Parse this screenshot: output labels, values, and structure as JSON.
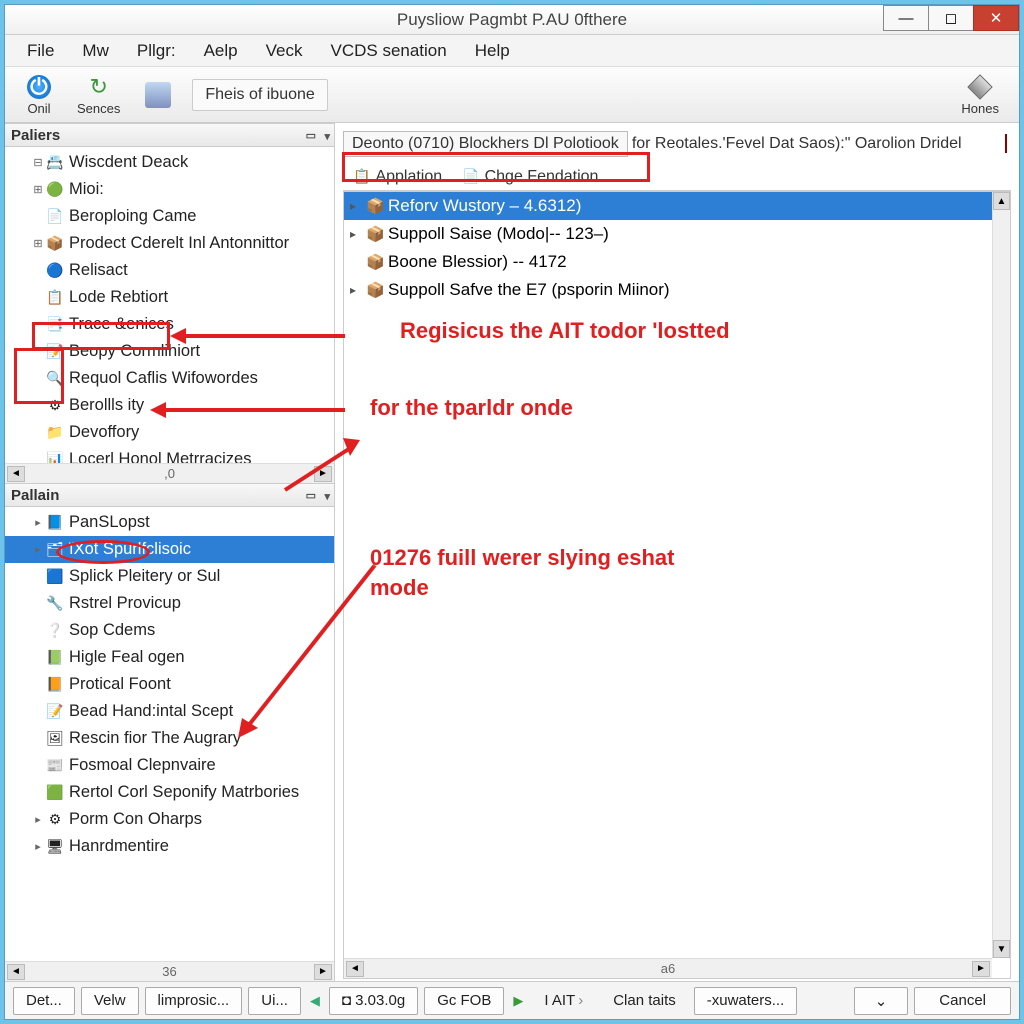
{
  "title": "Puysliow Pagmbt P.AU 0fthere",
  "menus": [
    "File",
    "Mw",
    "Pllgr:",
    "Aelp",
    "Veck",
    "VCDS senation",
    "Help"
  ],
  "toolbar": {
    "onil": "Onil",
    "sences": "Sences",
    "fheis": "Fheis of ibuone",
    "hones": "Hones"
  },
  "panels": {
    "paliers": {
      "title": "Paliers",
      "items": [
        {
          "icon": "📇",
          "label": "Wiscdent Deack",
          "expander": "⊟"
        },
        {
          "icon": "🟢",
          "label": "Mioi:",
          "expander": "⊞"
        },
        {
          "icon": "📄",
          "label": "Beroploing Came",
          "expander": ""
        },
        {
          "icon": "📦",
          "label": "Prodect Cderelt Inl Antonnittor",
          "expander": "⊞"
        },
        {
          "icon": "🔵",
          "label": "Relisact",
          "expander": ""
        },
        {
          "icon": "📋",
          "label": "Lode Rebtiort",
          "expander": ""
        },
        {
          "icon": "📑",
          "label": "Trace &enices",
          "expander": ""
        },
        {
          "icon": "📝",
          "label": "Beopy Cormlihiort",
          "expander": ""
        },
        {
          "icon": "🔍",
          "label": "Requol Caflis Wifowordes",
          "expander": ""
        },
        {
          "icon": "⚙",
          "label": "Berollls ity",
          "expander": ""
        },
        {
          "icon": "📁",
          "label": "Devoffory",
          "expander": ""
        },
        {
          "icon": "📊",
          "label": "Locerl Honol Metrracizes",
          "expander": ""
        }
      ],
      "scroll_label": ",0"
    },
    "pallain": {
      "title": "Pallain",
      "items": [
        {
          "icon": "📘",
          "label": "PanSLopst",
          "expander": "▸"
        },
        {
          "icon": "🗂",
          "label": "ïXot Spurlfclisoic",
          "expander": "▸",
          "selected": true
        },
        {
          "icon": "🟦",
          "label": "Splick Pleitery or Sul",
          "expander": ""
        },
        {
          "icon": "🔧",
          "label": "Rstrel Provicup",
          "expander": ""
        },
        {
          "icon": "❔",
          "label": "Sop Cdems",
          "expander": ""
        },
        {
          "icon": "📗",
          "label": "Higle Feal ogen",
          "expander": ""
        },
        {
          "icon": "📙",
          "label": "Protical Foont",
          "expander": ""
        },
        {
          "icon": "📝",
          "label": "Bead Hand:intal Scept",
          "expander": ""
        },
        {
          "icon": "🖼",
          "label": "Rescin fior The Augrary",
          "expander": ""
        },
        {
          "icon": "📰",
          "label": "Fosmoal Clepnvaire",
          "expander": ""
        },
        {
          "icon": "🟩",
          "label": "Rertol Corl Seponify Matrbories",
          "expander": ""
        },
        {
          "icon": "⚙",
          "label": "Porm Con Oharps",
          "expander": "▸"
        },
        {
          "icon": "🖥",
          "label": "Hanrdmentire",
          "expander": "▸"
        }
      ],
      "scroll_label": "36"
    }
  },
  "breadcrumb": {
    "box": "Deonto (0710) Blockhers Dl Polotiook",
    "rest": "for Reotales.'Fevel Dat Saos):\" Oarolion Dridel"
  },
  "subtabs": {
    "applation": "Applation",
    "chge": "Chge Fendation"
  },
  "main_items": [
    {
      "expander": "▸",
      "icon": "📦",
      "label": "Reforv Wustory – 4.6312)",
      "selected": true
    },
    {
      "expander": "▸",
      "icon": "📦",
      "label": "Suppoll Saise (Modo|-- 123–)"
    },
    {
      "expander": "",
      "icon": "📦",
      "label": "Boone Blessior) -- 4172"
    },
    {
      "expander": "▸",
      "icon": "📦",
      "label": "Suppoll Safve the E7 (psporin Miinor)"
    }
  ],
  "main_scroll_label": "a6",
  "bottom": {
    "det": "Det...",
    "velw": "Velw",
    "improsic": "limprosic...",
    "ui": "Ui...",
    "num": "3.03.0g",
    "gfob": "Gc FOB",
    "iait": "I AIT",
    "clantaits": "Clan taits",
    "xuwaters": "-xuwaters...",
    "cancel": "Cancel"
  },
  "annotations": {
    "line1": "Regisicus the AIT todor 'lostted",
    "line2": "for the tparldr onde",
    "line3a": "01276 fuill werer slying eshat",
    "line3b": "mode"
  }
}
